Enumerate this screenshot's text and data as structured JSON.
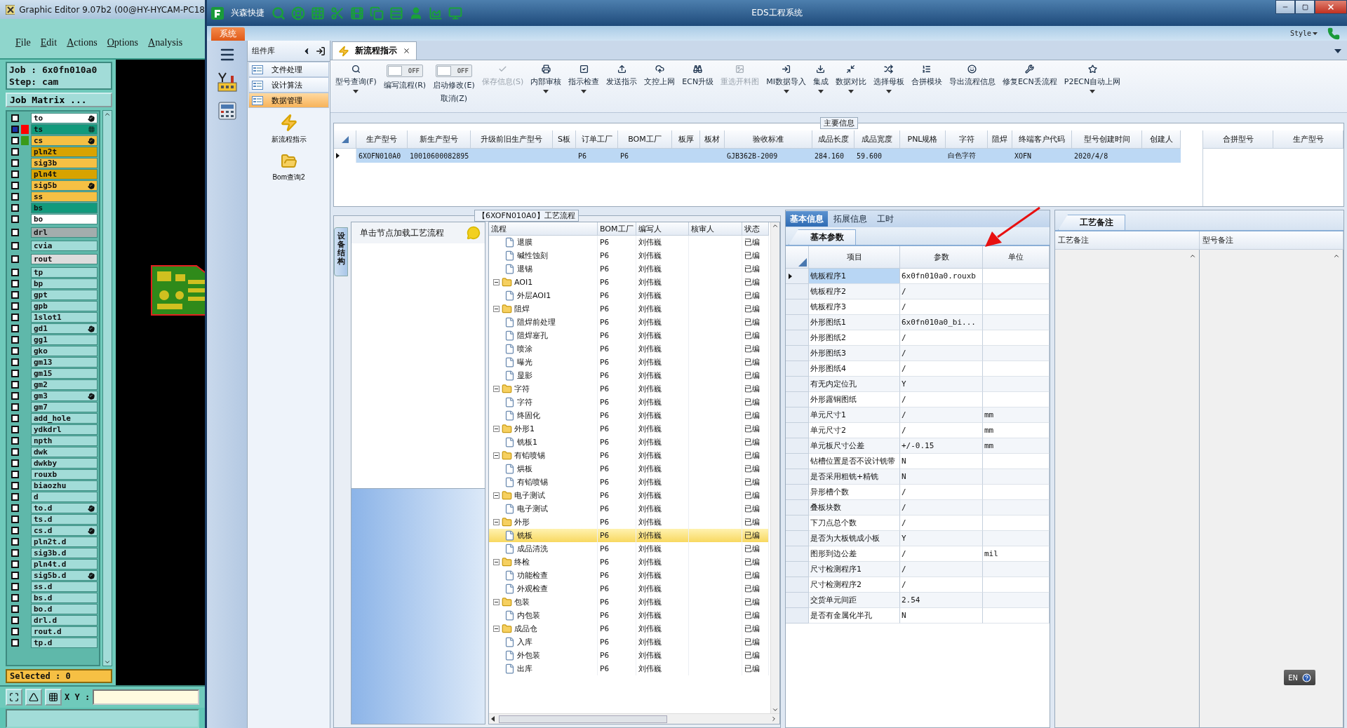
{
  "editor": {
    "title": "Graphic Editor 9.07b2 (00@HY-HYCAM-PC18",
    "menu": [
      "File",
      "Edit",
      "Actions",
      "Options",
      "Analysis"
    ],
    "job": "Job : 6x0fn010a0",
    "step": "Step: cam",
    "matrix_button": "Job Matrix ...",
    "selected_count": "Selected : 0",
    "coord_label": "X Y :",
    "layer_groups": [
      [
        {
          "name": "to",
          "color": "#ffffff",
          "checked": false,
          "mark": {
            "kind": "hand"
          }
        },
        {
          "name": "ts",
          "color": "#129a7c",
          "checked": true,
          "swatch": {
            "color": "#ff0000"
          },
          "mark": {
            "kind": "grid"
          }
        },
        {
          "name": "cs",
          "color": "#f6c044",
          "checked": false,
          "swatch": {
            "color": "#3a9a1a"
          },
          "mark": {
            "kind": "hand"
          }
        },
        {
          "name": "pln2t",
          "color": "#d8a300",
          "checked": false
        },
        {
          "name": "sig3b",
          "color": "#f6c044",
          "checked": false
        },
        {
          "name": "pln4t",
          "color": "#d8a300",
          "checked": false
        },
        {
          "name": "sig5b",
          "color": "#f6c044",
          "checked": false,
          "mark": {
            "kind": "hand"
          }
        },
        {
          "name": "ss",
          "color": "#f6c044",
          "checked": false
        },
        {
          "name": "bs",
          "color": "#129a7c",
          "checked": false
        },
        {
          "name": "bo",
          "color": "#ffffff",
          "checked": false
        }
      ],
      [
        {
          "name": "drl",
          "color": "#a3adad",
          "checked": false
        }
      ],
      [
        {
          "name": "cvia",
          "color": "#a2dcd8",
          "checked": false
        }
      ],
      [
        {
          "name": "rout",
          "color": "#dcdcdc",
          "checked": false
        }
      ],
      [
        {
          "name": "tp",
          "color": "#a2dcd8",
          "checked": false
        },
        {
          "name": "bp",
          "color": "#a2dcd8",
          "checked": false
        },
        {
          "name": "gpt",
          "color": "#a2dcd8",
          "checked": false
        },
        {
          "name": "gpb",
          "color": "#a2dcd8",
          "checked": false
        },
        {
          "name": "1slot1",
          "color": "#a2dcd8",
          "checked": false
        },
        {
          "name": "gd1",
          "color": "#a2dcd8",
          "checked": false,
          "mark": {
            "kind": "hand"
          }
        },
        {
          "name": "gg1",
          "color": "#a2dcd8",
          "checked": false
        },
        {
          "name": "gko",
          "color": "#a2dcd8",
          "checked": false
        },
        {
          "name": "gm13",
          "color": "#a2dcd8",
          "checked": false
        },
        {
          "name": "gm15",
          "color": "#a2dcd8",
          "checked": false
        },
        {
          "name": "gm2",
          "color": "#a2dcd8",
          "checked": false
        },
        {
          "name": "gm3",
          "color": "#a2dcd8",
          "checked": false,
          "mark": {
            "kind": "hand"
          }
        },
        {
          "name": "gm7",
          "color": "#a2dcd8",
          "checked": false
        },
        {
          "name": "add_hole",
          "color": "#a2dcd8",
          "checked": false
        },
        {
          "name": "ydkdrl",
          "color": "#a2dcd8",
          "checked": false
        },
        {
          "name": "npth",
          "color": "#a2dcd8",
          "checked": false
        },
        {
          "name": "dwk",
          "color": "#a2dcd8",
          "checked": false
        },
        {
          "name": "dwkby",
          "color": "#a2dcd8",
          "checked": false
        },
        {
          "name": "rouxb",
          "color": "#a2dcd8",
          "checked": false
        },
        {
          "name": "biaozhu",
          "color": "#a2dcd8",
          "checked": false
        },
        {
          "name": "d",
          "color": "#a2dcd8",
          "checked": false
        },
        {
          "name": "to.d",
          "color": "#a2dcd8",
          "checked": false,
          "mark": {
            "kind": "hand"
          }
        },
        {
          "name": "ts.d",
          "color": "#a2dcd8",
          "checked": false
        },
        {
          "name": "cs.d",
          "color": "#a2dcd8",
          "checked": false,
          "mark": {
            "kind": "hand"
          }
        },
        {
          "name": "pln2t.d",
          "color": "#a2dcd8",
          "checked": false
        },
        {
          "name": "sig3b.d",
          "color": "#a2dcd8",
          "checked": false
        },
        {
          "name": "pln4t.d",
          "color": "#a2dcd8",
          "checked": false
        },
        {
          "name": "sig5b.d",
          "color": "#a2dcd8",
          "checked": false,
          "mark": {
            "kind": "hand"
          }
        },
        {
          "name": "ss.d",
          "color": "#a2dcd8",
          "checked": false
        },
        {
          "name": "bs.d",
          "color": "#a2dcd8",
          "checked": false
        },
        {
          "name": "bo.d",
          "color": "#a2dcd8",
          "checked": false
        },
        {
          "name": "drl.d",
          "color": "#a2dcd8",
          "checked": false
        },
        {
          "name": "rout.d",
          "color": "#a2dcd8",
          "checked": false
        },
        {
          "name": "tp.d",
          "color": "#a2dcd8",
          "checked": false
        }
      ]
    ]
  },
  "eds": {
    "title": "EDS工程系统",
    "quick_label": "兴森快捷",
    "system_tab": "系统",
    "style_label": "Style",
    "component_panel": {
      "title": "组件库",
      "items": [
        {
          "label": "文件处理",
          "selected": false
        },
        {
          "label": "设计算法",
          "selected": false
        },
        {
          "label": "数据管理",
          "selected": true
        }
      ],
      "tools": [
        "新流程指示",
        "Bom查询2"
      ]
    },
    "doc_tabs": [
      {
        "label": "新流程指示",
        "selected": true
      }
    ],
    "toolbar": [
      {
        "kind": "button",
        "label": "型号查询(F)",
        "dropdown": true,
        "disabled": false
      },
      {
        "kind": "toggle",
        "label": "编写流程(R)",
        "state_text": "OFF",
        "on": false
      },
      {
        "kind": "toggle",
        "label": "启动修改(E)",
        "sub_label": "取消(Z)",
        "state_text": "OFF",
        "on": false
      },
      {
        "kind": "button",
        "label": "保存信息(S)",
        "dropdown": false,
        "disabled": true
      },
      {
        "kind": "button",
        "label": "内部审核",
        "dropdown": true,
        "disabled": false
      },
      {
        "kind": "button",
        "label": "指示检查",
        "dropdown": true,
        "disabled": false
      },
      {
        "kind": "button",
        "label": "发送指示",
        "dropdown": false,
        "disabled": false
      },
      {
        "kind": "button",
        "label": "文控上网",
        "dropdown": false,
        "disabled": false
      },
      {
        "kind": "button",
        "label": "ECN升级",
        "dropdown": false,
        "disabled": false
      },
      {
        "kind": "button",
        "label": "重选开料图",
        "dropdown": false,
        "disabled": true
      },
      {
        "kind": "button",
        "label": "MI数据导入",
        "dropdown": true,
        "disabled": false
      },
      {
        "kind": "button",
        "label": "集成",
        "dropdown": true,
        "disabled": false
      },
      {
        "kind": "button",
        "label": "数据对比",
        "dropdown": true,
        "disabled": false
      },
      {
        "kind": "button",
        "label": "选择母板",
        "dropdown": true,
        "disabled": false
      },
      {
        "kind": "button",
        "label": "合拼模块",
        "dropdown": false,
        "disabled": false
      },
      {
        "kind": "button",
        "label": "导出流程信息",
        "dropdown": false,
        "disabled": false
      },
      {
        "kind": "button",
        "label": "修复ECN丢流程",
        "dropdown": false,
        "disabled": false
      },
      {
        "kind": "button",
        "label": "P2ECN自动上网",
        "dropdown": true,
        "disabled": false
      }
    ],
    "main_info": {
      "title": "主要信息",
      "columns": [
        "生产型号",
        "新生产型号",
        "升级前旧生产型号",
        "S板",
        "订单工厂",
        "BOM工厂",
        "板厚",
        "板材",
        "验收标准",
        "成品长度",
        "成品宽度",
        "PNL规格",
        "字符",
        "阻焊",
        "终端客户代码",
        "型号创建时间",
        "创建人"
      ],
      "rows": [
        {
          "selected": true,
          "cells": [
            "6XOFN010A0",
            "10010600082895",
            "",
            "",
            "P6",
            "P6",
            "",
            "",
            "GJB362B-2009",
            "284.160",
            "59.600",
            "",
            "白色字符",
            "",
            "XOFN",
            "2020/4/8",
            ""
          ]
        }
      ],
      "side_columns": [
        "合拼型号",
        "生产型号"
      ]
    },
    "flow": {
      "title": "【6XOFN010A0】工艺流程",
      "side_tab": "设备结构",
      "hint": "单击节点加载工艺流程",
      "columns": [
        "流程",
        "BOM工厂",
        "编写人",
        "核审人",
        "状态"
      ],
      "nodes": [
        {
          "children": [
            {
              "name": "退膜",
              "bom": "P6",
              "writer": "刘伟巍",
              "status": "已编",
              "selected": false
            },
            {
              "name": "碱性蚀刻",
              "bom": "P6",
              "writer": "刘伟巍",
              "status": "已编",
              "selected": false
            },
            {
              "name": "退锡",
              "bom": "P6",
              "writer": "刘伟巍",
              "status": "已编",
              "selected": false
            }
          ]
        },
        {
          "name": "AOI1",
          "bom": "P6",
          "writer": "刘伟巍",
          "status": "已编",
          "selected": false,
          "expanded": true,
          "children": [
            {
              "name": "外层AOI1",
              "bom": "P6",
              "writer": "刘伟巍",
              "status": "已编",
              "selected": false
            }
          ]
        },
        {
          "name": "阻焊",
          "bom": "P6",
          "writer": "刘伟巍",
          "status": "已编",
          "selected": false,
          "expanded": true,
          "children": [
            {
              "name": "阻焊前处理",
              "bom": "P6",
              "writer": "刘伟巍",
              "status": "已编",
              "selected": false
            },
            {
              "name": "阻焊塞孔",
              "bom": "P6",
              "writer": "刘伟巍",
              "status": "已编",
              "selected": false
            },
            {
              "name": "喷涂",
              "bom": "P6",
              "writer": "刘伟巍",
              "status": "已编",
              "selected": false
            },
            {
              "name": "曝光",
              "bom": "P6",
              "writer": "刘伟巍",
              "status": "已编",
              "selected": false
            },
            {
              "name": "显影",
              "bom": "P6",
              "writer": "刘伟巍",
              "status": "已编",
              "selected": false
            }
          ]
        },
        {
          "name": "字符",
          "bom": "P6",
          "writer": "刘伟巍",
          "status": "已编",
          "selected": false,
          "expanded": true,
          "children": [
            {
              "name": "字符",
              "bom": "P6",
              "writer": "刘伟巍",
              "status": "已编",
              "selected": false
            },
            {
              "name": "终固化",
              "bom": "P6",
              "writer": "刘伟巍",
              "status": "已编",
              "selected": false
            }
          ]
        },
        {
          "name": "外形1",
          "bom": "P6",
          "writer": "刘伟巍",
          "status": "已编",
          "selected": false,
          "expanded": true,
          "children": [
            {
              "name": "铣板1",
              "bom": "P6",
              "writer": "刘伟巍",
              "status": "已编",
              "selected": false
            }
          ]
        },
        {
          "name": "有铅喷锡",
          "bom": "P6",
          "writer": "刘伟巍",
          "status": "已编",
          "selected": false,
          "expanded": true,
          "children": [
            {
              "name": "烘板",
              "bom": "P6",
              "writer": "刘伟巍",
              "status": "已编",
              "selected": false
            },
            {
              "name": "有铅喷锡",
              "bom": "P6",
              "writer": "刘伟巍",
              "status": "已编",
              "selected": false
            }
          ]
        },
        {
          "name": "电子测试",
          "bom": "P6",
          "writer": "刘伟巍",
          "status": "已编",
          "selected": false,
          "expanded": true,
          "children": [
            {
              "name": "电子测试",
              "bom": "P6",
              "writer": "刘伟巍",
              "status": "已编",
              "selected": false
            }
          ]
        },
        {
          "name": "外形",
          "bom": "P6",
          "writer": "刘伟巍",
          "status": "已编",
          "selected": false,
          "expanded": true,
          "children": [
            {
              "name": "铣板",
              "bom": "P6",
              "writer": "刘伟巍",
              "status": "已编",
              "selected": true
            },
            {
              "name": "成品清洗",
              "bom": "P6",
              "writer": "刘伟巍",
              "status": "已编",
              "selected": false
            }
          ]
        },
        {
          "name": "终检",
          "bom": "P6",
          "writer": "刘伟巍",
          "status": "已编",
          "selected": false,
          "expanded": true,
          "children": [
            {
              "name": "功能检查",
              "bom": "P6",
              "writer": "刘伟巍",
              "status": "已编",
              "selected": false
            },
            {
              "name": "外观检查",
              "bom": "P6",
              "writer": "刘伟巍",
              "status": "已编",
              "selected": false
            }
          ]
        },
        {
          "name": "包装",
          "bom": "P6",
          "writer": "刘伟巍",
          "status": "已编",
          "selected": false,
          "expanded": true,
          "children": [
            {
              "name": "内包装",
              "bom": "P6",
              "writer": "刘伟巍",
              "status": "已编",
              "selected": false
            }
          ]
        },
        {
          "name": "成品仓",
          "bom": "P6",
          "writer": "刘伟巍",
          "status": "已编",
          "selected": false,
          "expanded": true,
          "children": [
            {
              "name": "入库",
              "bom": "P6",
              "writer": "刘伟巍",
              "status": "已编",
              "selected": false
            },
            {
              "name": "外包装",
              "bom": "P6",
              "writer": "刘伟巍",
              "status": "已编",
              "selected": false
            },
            {
              "name": "出库",
              "bom": "P6",
              "writer": "刘伟巍",
              "status": "已编",
              "selected": false
            }
          ]
        }
      ]
    },
    "params": {
      "tabs": [
        {
          "label": "基本信息",
          "selected": true
        },
        {
          "label": "拓展信息",
          "selected": false
        },
        {
          "label": "工时",
          "selected": false
        }
      ],
      "sub_tab": "基本参数",
      "columns": [
        "项目",
        "参数",
        "单位"
      ],
      "rows": [
        {
          "item": "铣板程序1",
          "value": "6x0fn010a0.rouxb",
          "unit": "",
          "selected": true
        },
        {
          "item": "铣板程序2",
          "value": "/",
          "unit": "",
          "selected": false
        },
        {
          "item": "铣板程序3",
          "value": "/",
          "unit": "",
          "selected": false
        },
        {
          "item": "外形图纸1",
          "value": "6x0fn010a0_bi...",
          "unit": "",
          "selected": false
        },
        {
          "item": "外形图纸2",
          "value": "/",
          "unit": "",
          "selected": false
        },
        {
          "item": "外形图纸3",
          "value": "/",
          "unit": "",
          "selected": false
        },
        {
          "item": "外形图纸4",
          "value": "/",
          "unit": "",
          "selected": false
        },
        {
          "item": "有无内定位孔",
          "value": "Y",
          "unit": "",
          "selected": false
        },
        {
          "item": "外形露铜图纸",
          "value": "/",
          "unit": "",
          "selected": false
        },
        {
          "item": "单元尺寸1",
          "value": "/",
          "unit": "mm",
          "selected": false
        },
        {
          "item": "单元尺寸2",
          "value": "/",
          "unit": "mm",
          "selected": false
        },
        {
          "item": "单元板尺寸公差",
          "value": "+/-0.15",
          "unit": "mm",
          "selected": false
        },
        {
          "item": "钻槽位置是否不设计铣带",
          "value": "N",
          "unit": "",
          "selected": false
        },
        {
          "item": "是否采用粗铣+精铣",
          "value": "N",
          "unit": "",
          "selected": false
        },
        {
          "item": "异形槽个数",
          "value": "/",
          "unit": "",
          "selected": false
        },
        {
          "item": "叠板块数",
          "value": "/",
          "unit": "",
          "selected": false
        },
        {
          "item": "下刀点总个数",
          "value": "/",
          "unit": "",
          "selected": false
        },
        {
          "item": "是否为大板铣成小板",
          "value": "Y",
          "unit": "",
          "selected": false
        },
        {
          "item": "图形到边公差",
          "value": "/",
          "unit": "mil",
          "selected": false
        },
        {
          "item": "尺寸检测程序1",
          "value": "/",
          "unit": "",
          "selected": false
        },
        {
          "item": "尺寸检测程序2",
          "value": "/",
          "unit": "",
          "selected": false
        },
        {
          "item": "交货单元间距",
          "value": "2.54",
          "unit": "",
          "selected": false
        },
        {
          "item": "是否有金属化半孔",
          "value": "N",
          "unit": "",
          "selected": false
        }
      ]
    },
    "remarks": {
      "tab": "工艺备注",
      "columns": [
        "工艺备注",
        "型号备注"
      ]
    },
    "lang_bar": {
      "label": "EN"
    }
  }
}
